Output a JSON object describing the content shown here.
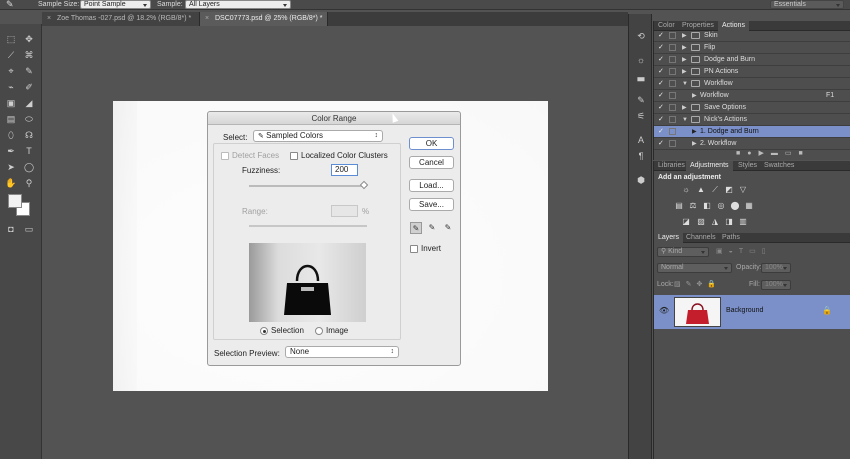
{
  "options_bar": {
    "sample_size_label": "Sample Size:",
    "sample_size_value": "Point Sample",
    "sample_label": "Sample:",
    "sample_value": "All Layers",
    "workspace_value": "Essentials"
  },
  "doc_tabs": [
    {
      "title": "Zoe Thomas -027.psd @ 18.2% (RGB/8*) *",
      "close": "×"
    },
    {
      "title": "DSC07773.psd @ 25% (RGB/8*) *",
      "close": "×"
    }
  ],
  "tools": [
    "⌖",
    "✥",
    "⬚",
    "⟋",
    "⌘",
    "✎",
    "⌁",
    "✐",
    "▣",
    "◢",
    "▤",
    "⬭",
    "⬯",
    "☊",
    "✒",
    "T",
    "➤",
    "◯",
    "✋",
    "⚲"
  ],
  "dialog": {
    "title": "Color Range",
    "select_label": "Select:",
    "select_value": "Sampled Colors",
    "detect_faces": "Detect Faces",
    "localized": "Localized Color Clusters",
    "fuzziness_label": "Fuzziness:",
    "fuzziness_value": "200",
    "range_label": "Range:",
    "range_unit": "%",
    "selection_label": "Selection",
    "image_label": "Image",
    "preview_label": "Selection Preview:",
    "preview_value": "None",
    "ok": "OK",
    "cancel": "Cancel",
    "load": "Load...",
    "save": "Save...",
    "invert": "Invert"
  },
  "panel_tabs_top": [
    "Color",
    "Properties",
    "Actions"
  ],
  "actions": [
    {
      "label": "Skin",
      "check": "✓",
      "indent": 1
    },
    {
      "label": "Flip",
      "check": "✓",
      "indent": 1
    },
    {
      "label": "Dodge and Burn",
      "check": "✓",
      "indent": 1
    },
    {
      "label": "PN Actions",
      "check": "✓",
      "indent": 1
    },
    {
      "label": "Workflow",
      "check": "✓",
      "indent": 1
    },
    {
      "label": "Workflow",
      "check": "✓",
      "indent": 2,
      "key": "F1"
    },
    {
      "label": "Save Options",
      "check": "✓",
      "indent": 1
    },
    {
      "label": "Nick's Actions",
      "check": "✓",
      "indent": 1
    },
    {
      "label": "1. Dodge and Burn",
      "check": "✓",
      "indent": 2,
      "selected": true
    },
    {
      "label": "2. Workflow",
      "check": "✓",
      "indent": 2
    }
  ],
  "panel_tabs_mid": [
    "Libraries",
    "Adjustments",
    "Styles",
    "Swatches"
  ],
  "adjustments_title": "Add an adjustment",
  "panel_tabs_layers": [
    "Layers",
    "Channels",
    "Paths"
  ],
  "layers": {
    "kind_value": "Kind",
    "blend_value": "Normal",
    "opacity_label": "Opacity:",
    "opacity_value": "100%",
    "lock_label": "Lock:",
    "fill_label": "Fill:",
    "fill_value": "100%",
    "layer_name": "Background"
  },
  "colors": {
    "selection_blue": "#7b90c8",
    "bag": "#c41e2c"
  }
}
